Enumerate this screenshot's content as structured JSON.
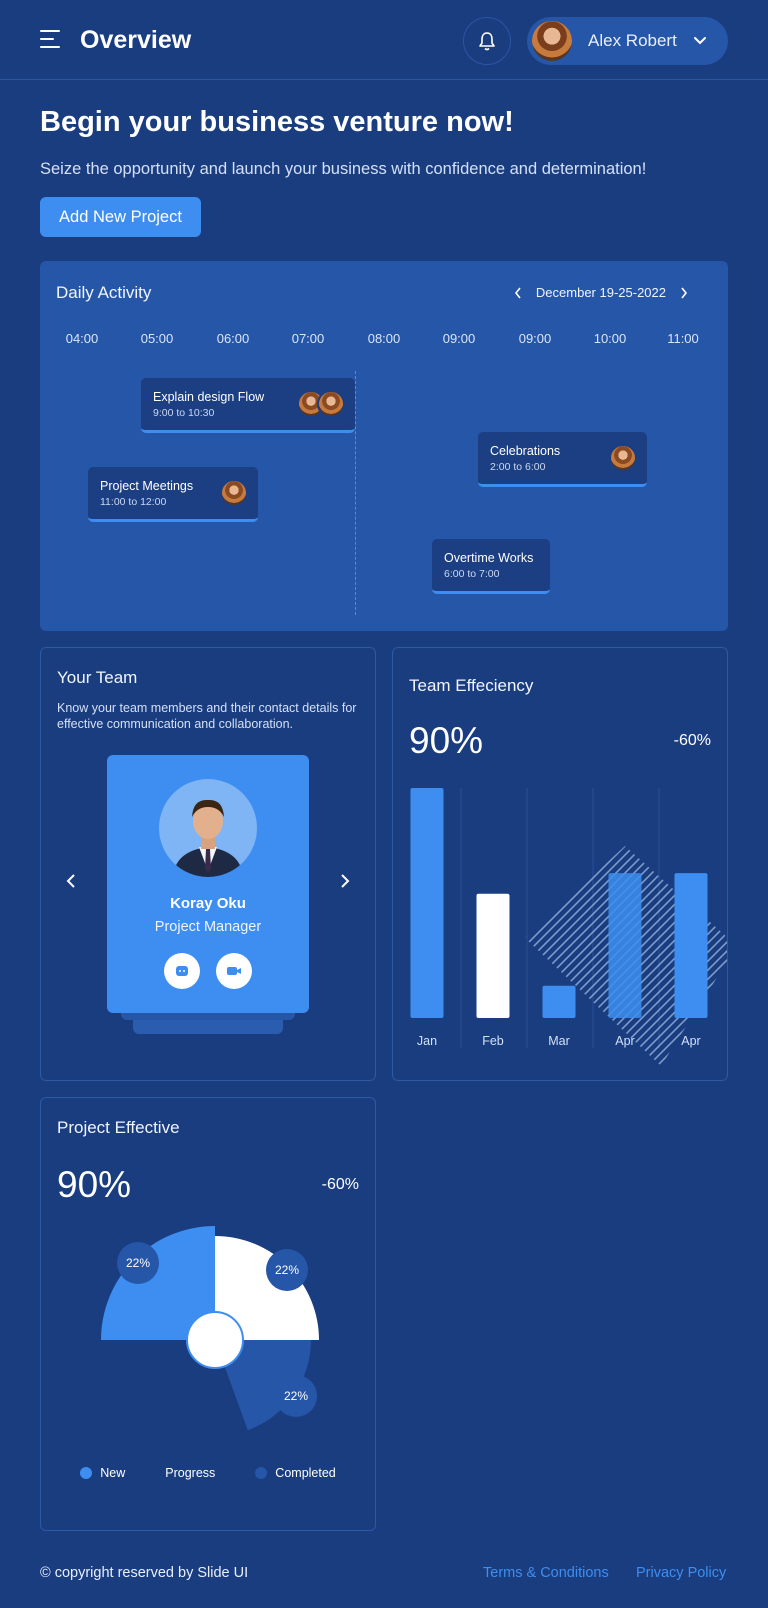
{
  "header": {
    "title": "Overview",
    "user_name": "Alex Robert"
  },
  "hero": {
    "title": "Begin your business venture now!",
    "subtitle": "Seize the opportunity and launch your business with confidence and determination!",
    "cta_label": "Add New Project"
  },
  "activity": {
    "title": "Daily Activity",
    "date_range": "December 19-25-2022",
    "times": [
      "04:00",
      "05:00",
      "06:00",
      "07:00",
      "08:00",
      "09:00",
      "09:00",
      "10:00",
      "11:00"
    ],
    "events": [
      {
        "title": "Explain design Flow",
        "time": "9:00 to 10:30"
      },
      {
        "title": "Celebrations",
        "time": "2:00 to 6:00"
      },
      {
        "title": "Project Meetings",
        "time": "11:00 to 12:00"
      },
      {
        "title": "Overtime Works",
        "time": "6:00 to 7:00"
      }
    ]
  },
  "team": {
    "title": "Your Team",
    "description": "Know your team members and their contact details for effective communication and collaboration.",
    "member_name": "Koray Oku",
    "member_role": "Project Manager"
  },
  "efficiency": {
    "title": "Team Effeciency",
    "value": "90%",
    "change": "-60%"
  },
  "project_effective": {
    "title": "Project Effective",
    "value": "90%",
    "change": "-60%",
    "legend": [
      "New",
      "Progress",
      "Completed"
    ]
  },
  "chart_data": [
    {
      "type": "bar",
      "title": "Team Effeciency",
      "categories": [
        "Jan",
        "Feb",
        "Mar",
        "Apr",
        "Apr"
      ],
      "values": [
        100,
        54,
        14,
        63,
        63
      ],
      "ylim": [
        0,
        100
      ],
      "colors": [
        "#3d8ef0",
        "#ffffff",
        "#3d8ef0",
        "#3d8ef0",
        "#3d8ef0"
      ]
    },
    {
      "type": "pie",
      "title": "Project Effective",
      "categories": [
        "New",
        "Progress",
        "Completed"
      ],
      "data_labels": [
        "22%",
        "22%",
        "22%"
      ],
      "colors": [
        "#3d8ef0",
        "#ffffff",
        "#2556a8"
      ]
    }
  ],
  "footer": {
    "copyright": "© copyright reserved by Slide UI",
    "terms": "Terms & Conditions",
    "privacy": "Privacy Policy"
  },
  "colors": {
    "background": "#1a3d80",
    "panel": "#2556a8",
    "accent": "#3d8ef0",
    "event_bg": "#1b3f82"
  },
  "icons": [
    "menu-icon",
    "bell-icon",
    "chevron-down-icon",
    "chevron-left-icon",
    "chevron-right-icon",
    "chat-icon",
    "video-icon"
  ]
}
